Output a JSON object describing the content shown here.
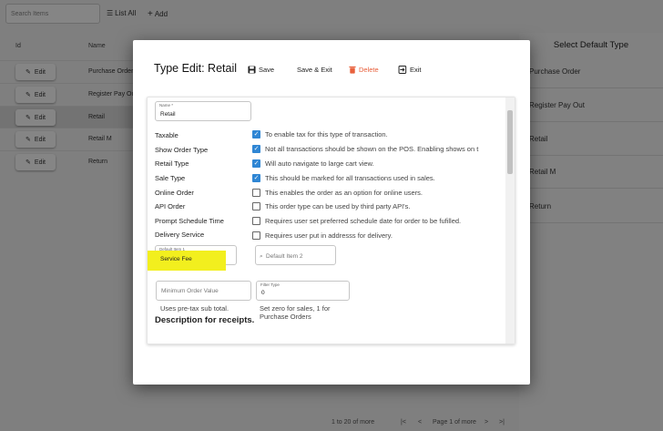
{
  "toolbar": {
    "search_placeholder": "Search Items",
    "list_all": "List All",
    "add": "Add"
  },
  "grid": {
    "col_id": "Id",
    "col_name": "Name",
    "edit_label": "Edit",
    "rows": [
      {
        "name": "Purchase Order"
      },
      {
        "name": "Register Pay Out"
      },
      {
        "name": "Retail"
      },
      {
        "name": "Retail M"
      },
      {
        "name": "Return"
      }
    ]
  },
  "right_panel": {
    "title": "Select Default Type",
    "items": [
      "Purchase Order",
      "Register Pay Out",
      "Retail",
      "Retail M",
      "Return"
    ]
  },
  "footer": {
    "range": "1 to 20 of more",
    "page": "Page 1 of more"
  },
  "modal": {
    "title": "Type Edit: Retail",
    "save": "Save",
    "save_exit": "Save & Exit",
    "delete": "Delete",
    "exit": "Exit",
    "name_label": "Name *",
    "name_value": "Retail",
    "labels": [
      "Taxable",
      "Show Order Type",
      "Retail Type",
      "Sale Type",
      "Online Order",
      "API Order",
      "Prompt Schedule Time",
      "Delivery Service"
    ],
    "checks": [
      {
        "text": "To enable tax for this type of transaction.",
        "checked": true
      },
      {
        "text": "Not all transactions should be shown on the POS. Enabling shows on t",
        "checked": true
      },
      {
        "text": "Will auto navigate to large cart view.",
        "checked": true
      },
      {
        "text": "This should be marked for all transactions used in sales.",
        "checked": true
      },
      {
        "text": "This enables the order as an option for online users.",
        "checked": false
      },
      {
        "text": "This order type can be used by third party API's.",
        "checked": false
      },
      {
        "text": "Requires user set preferred schedule date for order to be fufilled.",
        "checked": false
      },
      {
        "text": "Requires user put in addresss for delivery.",
        "checked": false
      }
    ],
    "default_item1_label": "Default Item 1",
    "default_item1_value": "Service Fee",
    "default_item2_placeholder": "Default Item 2",
    "min_order_placeholder": "Minimum Order Value",
    "min_order_hint": "Uses pre-tax sub total.",
    "filter_label": "Filter Type",
    "filter_value": "0",
    "filter_hint_1": "Set zero for sales, 1 for",
    "filter_hint_2": "Purchase Orders",
    "description_heading": "Description for receipts."
  },
  "colors": {
    "accent_checkbox": "#2f86d4",
    "delete": "#e8603c",
    "highlight": "#f2ef1e"
  }
}
